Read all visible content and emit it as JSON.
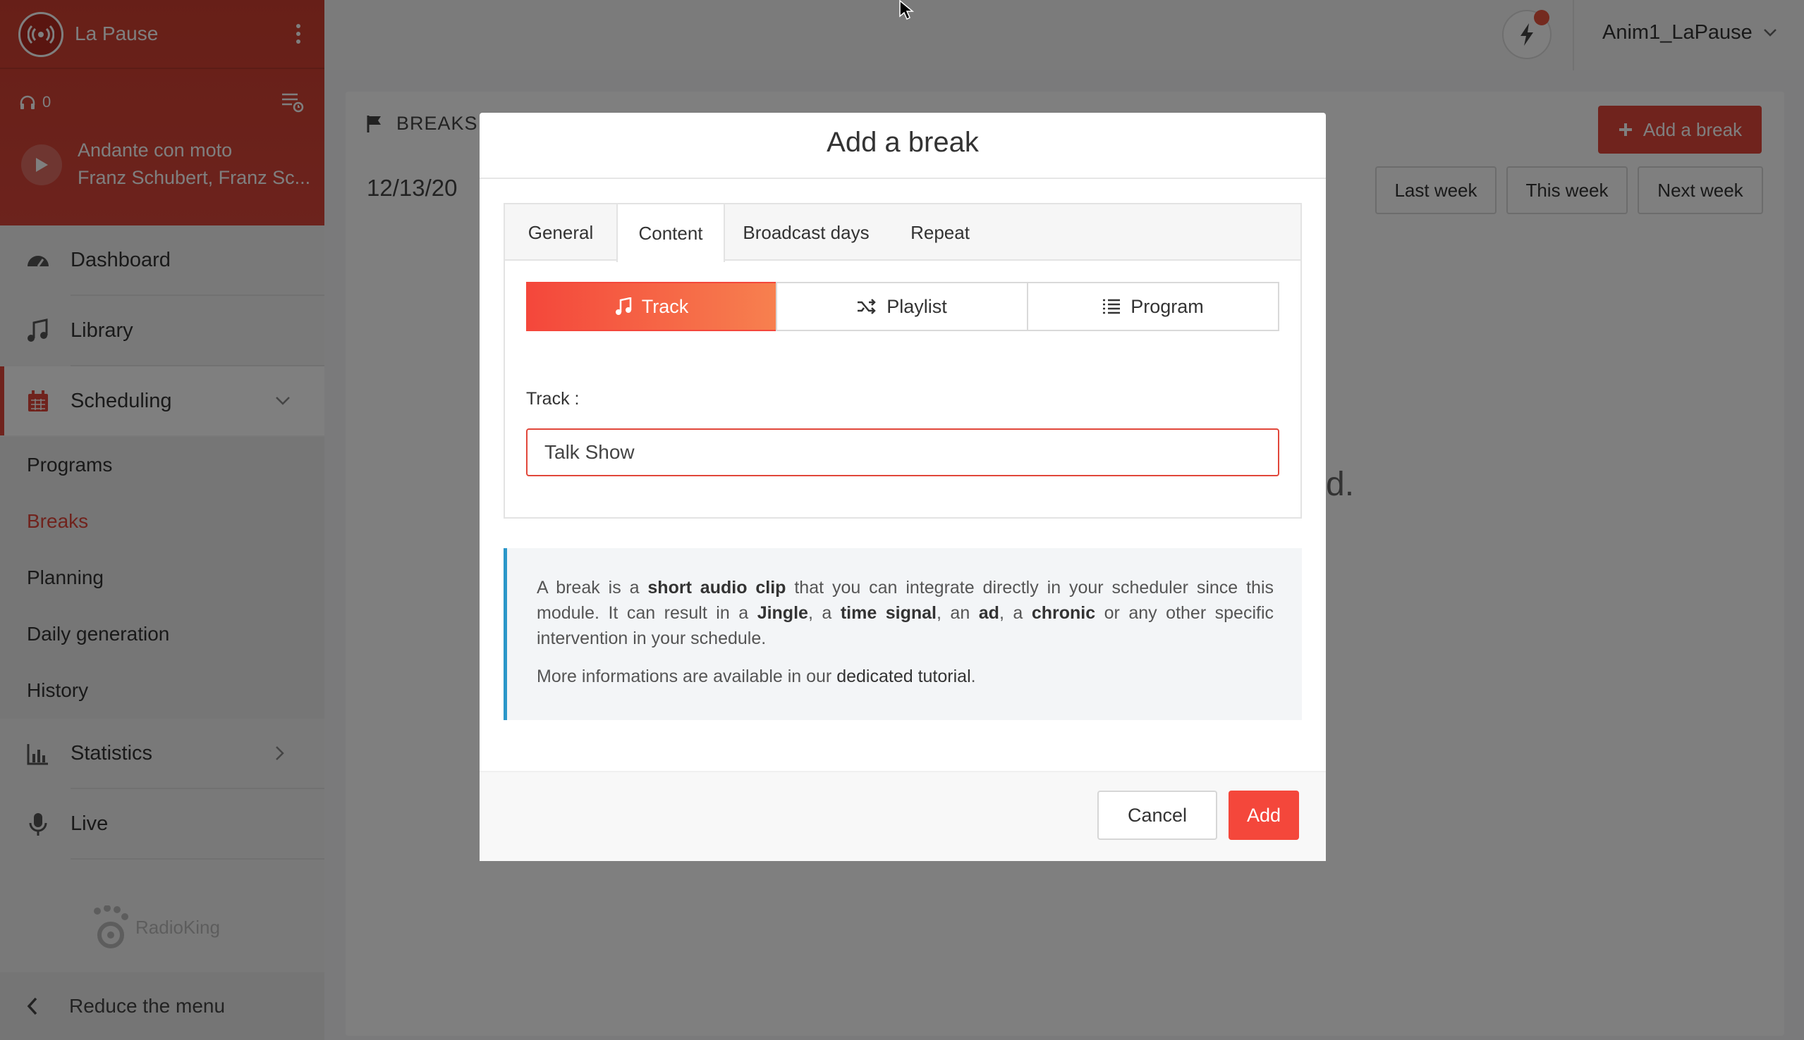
{
  "sidebar": {
    "station_name": "La Pause",
    "listeners": "0",
    "now_playing": {
      "title": "Andante con moto",
      "artist": "Franz Schubert, Franz Sc..."
    },
    "nav": {
      "dashboard": "Dashboard",
      "library": "Library",
      "scheduling": "Scheduling",
      "statistics": "Statistics",
      "live": "Live"
    },
    "scheduling_sub": [
      "Programs",
      "Breaks",
      "Planning",
      "Daily generation",
      "History"
    ],
    "brand": "RadioKing",
    "reduce_label": "Reduce the menu"
  },
  "topbar": {
    "user": "Anim1_LaPause"
  },
  "main": {
    "title": "BREAKS",
    "date": "12/13/20",
    "add_break": "Add a break",
    "weeks": [
      "Last week",
      "This week",
      "Next week"
    ],
    "empty_tail": "d."
  },
  "modal": {
    "title": "Add a break",
    "tabs": [
      "General",
      "Content",
      "Broadcast days",
      "Repeat"
    ],
    "active_tab": "Content",
    "content_types": [
      "Track",
      "Playlist",
      "Program"
    ],
    "active_type": "Track",
    "track_label": "Track :",
    "track_value": "Talk Show",
    "info": {
      "p1_a": "A break is a ",
      "p1_b": "short audio clip",
      "p1_c": " that you can integrate directly in your scheduler since this module. It can result in a ",
      "p1_d": "Jingle",
      "p1_e": ", a ",
      "p1_f": "time signal",
      "p1_g": ", an ",
      "p1_h": "ad",
      "p1_i": ", a ",
      "p1_j": "chronic",
      "p1_k": " or any other specific intervention in your schedule.",
      "p2_a": "More informations are available in our ",
      "p2_link": "dedicated tutorial",
      "p2_b": "."
    },
    "cancel": "Cancel",
    "add": "Add"
  },
  "colors": {
    "accent": "#e1473a",
    "info_border": "#2b97c9"
  }
}
